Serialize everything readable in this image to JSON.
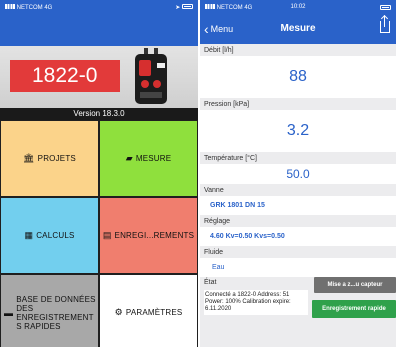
{
  "left": {
    "status": {
      "carrier": "NETCOM 4G"
    },
    "device_label": "1822-0",
    "version": "Version 18.3.0",
    "tiles": [
      {
        "label": "PROJETS",
        "icon": "building-icon"
      },
      {
        "label": "MESURE",
        "icon": "tag-icon"
      },
      {
        "label": "CALCULS",
        "icon": "grid-icon"
      },
      {
        "label": "ENREGI...REMENTS",
        "icon": "list-icon"
      },
      {
        "label_lines": [
          "BASE DE DONNÉES",
          "DES",
          "ENREGISTREMENT",
          "S RAPIDES"
        ],
        "icon": "folder-icon"
      },
      {
        "label": "PARAMÈTRES",
        "icon": "gear-icon"
      }
    ]
  },
  "right": {
    "status": {
      "carrier": "NETCOM 4G",
      "time": "10:02"
    },
    "nav": {
      "back": "Menu",
      "title": "Mesure"
    },
    "sections": {
      "debit": {
        "label": "Débit [l/h]",
        "value": "88"
      },
      "pression": {
        "label": "Pression [kPa]",
        "value": "3.2"
      },
      "temperature": {
        "label": "Température [°C]",
        "value": "50.0"
      },
      "vanne": {
        "label": "Vanne",
        "value": "GRK 1801  DN 15"
      },
      "reglage": {
        "label": "Réglage",
        "value": "4.60 Kv=0.50 Kvs=0.50"
      },
      "fluide": {
        "label": "Fluide",
        "value": "Eau"
      },
      "etat": {
        "label": "État",
        "text": "Connecté a 1822-0 Address: 51 Power: 100% Calibration expire: 6.11.2020"
      }
    },
    "buttons": {
      "sensor": "Mise a z...u capteur",
      "save": "Enregistrement rapide"
    }
  },
  "colors": {
    "primary": "#2a62c9",
    "accent_red": "#e23a3a",
    "green": "#2fa14b"
  }
}
